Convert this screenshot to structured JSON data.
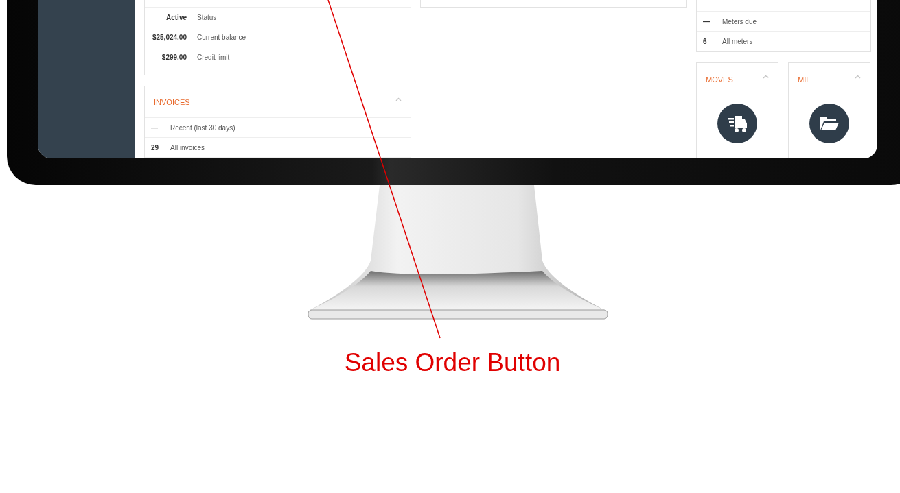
{
  "account": {
    "rows": [
      {
        "value": "Active",
        "label": "Status"
      },
      {
        "value": "$25,024.00",
        "label": "Current balance"
      },
      {
        "value": "$299.00",
        "label": "Credit limit"
      }
    ]
  },
  "invoices": {
    "title": "INVOICES",
    "rows": [
      {
        "count": "—",
        "label": "Recent (last 30 days)"
      },
      {
        "count": "29",
        "label": "All invoices"
      }
    ]
  },
  "meters": {
    "rows": [
      {
        "count": "—",
        "label": "Meters due"
      },
      {
        "count": "6",
        "label": "All meters"
      }
    ]
  },
  "tiles": [
    {
      "title": "MOVES",
      "kind": "moves"
    },
    {
      "title": "MIF",
      "kind": "mif"
    }
  ],
  "annotation": {
    "label": "Sales Order Button"
  }
}
